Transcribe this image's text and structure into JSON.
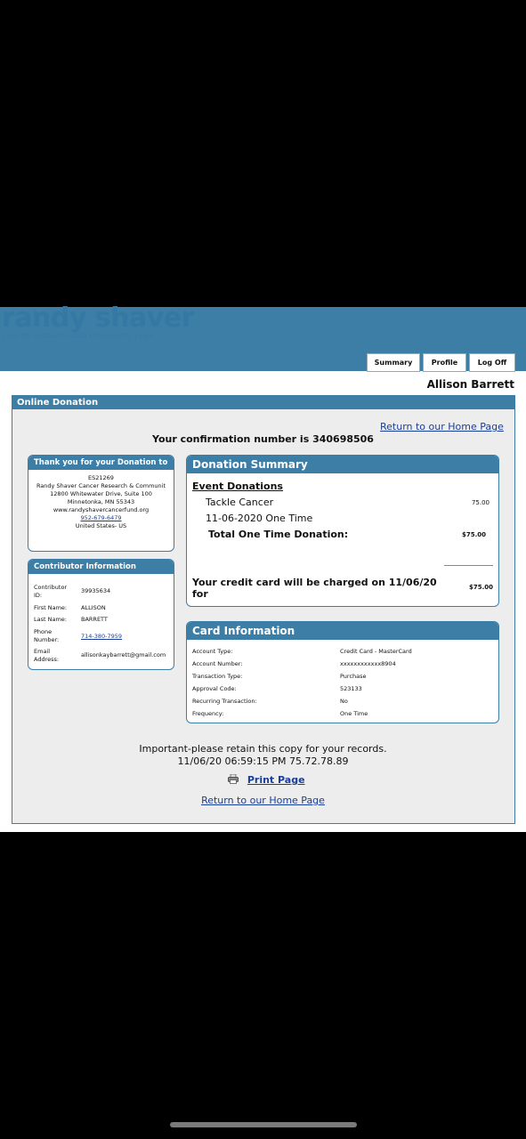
{
  "header": {
    "brand": "randy shaver",
    "tagline": "CANCER RESEARCH AND COMMUNITY FUND",
    "tabs": [
      "Summary",
      "Profile",
      "Log Off"
    ],
    "user_name": "Allison Barrett"
  },
  "section_title": "Online Donation",
  "return_home_label": "Return to our Home Page",
  "confirmation_text": "Your confirmation number is 340698506",
  "thank_you": {
    "title": "Thank you for your Donation to",
    "lines": [
      "ES21269",
      "Randy Shaver Cancer Research & Communit",
      "12800 Whitewater Drive, Suite 100",
      "Minnetonka, MN 55343",
      "www.randyshavercancerfund.org"
    ],
    "phone": "952-679-6479",
    "country": "United States- US"
  },
  "contributor": {
    "title": "Contributor Information",
    "rows": [
      {
        "label": "Contributor ID:",
        "value": "39935634"
      },
      {
        "label": "First Name:",
        "value": "ALLISON"
      },
      {
        "label": "Last Name:",
        "value": "BARRETT"
      },
      {
        "label": "Phone Number:",
        "value": "714-380-7959"
      },
      {
        "label": "Email Address:",
        "value": "allisonkaybarrett@gmail.com"
      }
    ]
  },
  "donation_summary": {
    "title": "Donation Summary",
    "event_heading": "Event Donations",
    "event_name": "Tackle Cancer",
    "event_amount": "75.00",
    "event_date_type": "11-06-2020 One Time",
    "total_label": "Total One Time Donation:",
    "total_value": "$75.00",
    "charge_text": "Your credit card will be charged on 11/06/20 for",
    "charge_value": "$75.00"
  },
  "card_info": {
    "title": "Card Information",
    "rows": [
      {
        "label": "Account Type:",
        "value": "Credit Card - MasterCard"
      },
      {
        "label": "Account Number:",
        "value": "xxxxxxxxxxxx8904"
      },
      {
        "label": "Transaction Type:",
        "value": "Purchase"
      },
      {
        "label": "Approval Code:",
        "value": "523133"
      },
      {
        "label": "Recurring Transaction:",
        "value": "No"
      },
      {
        "label": "Frequency:",
        "value": "One Time"
      }
    ]
  },
  "footer": {
    "important": "Important-please retain this copy for your records.",
    "timestamp": "11/06/20 06:59:15 PM 75.72.78.89",
    "print_label": "Print Page",
    "print_icon": "printer-icon"
  }
}
